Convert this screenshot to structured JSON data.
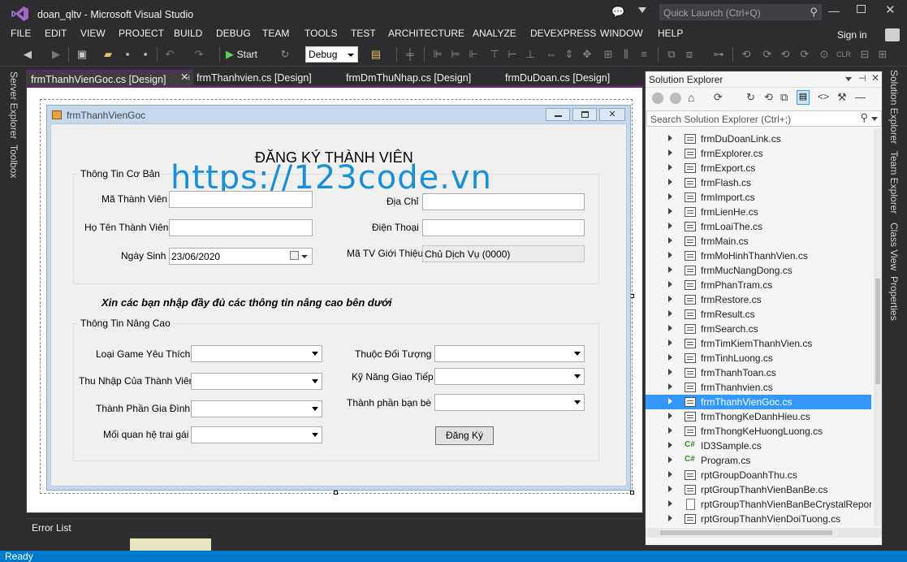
{
  "window": {
    "title": "doan_qltv - Microsoft Visual Studio",
    "quick_launch_placeholder": "Quick Launch (Ctrl+Q)",
    "sign_in": "Sign in"
  },
  "menu": [
    "FILE",
    "EDIT",
    "VIEW",
    "PROJECT",
    "BUILD",
    "DEBUG",
    "TEAM",
    "TOOLS",
    "TEST",
    "ARCHITECTURE",
    "ANALYZE",
    "DEVEXPRESS",
    "WINDOW",
    "HELP"
  ],
  "toolbar": {
    "start_label": "Start",
    "config_value": "Debug"
  },
  "left_rail": {
    "server_explorer": "Server Explorer",
    "toolbox": "Toolbox"
  },
  "right_rail": {
    "solution_explorer": "Solution Explorer",
    "team_explorer": "Team Explorer",
    "class_view": "Class View",
    "properties": "Properties"
  },
  "tabs": [
    {
      "label": "frmThanhVienGoc.cs [Design]",
      "active": true
    },
    {
      "label": "frmThanhvien.cs [Design]",
      "active": false
    },
    {
      "label": "frmDmThuNhap.cs [Design]",
      "active": false
    },
    {
      "label": "frmDuDoan.cs [Design]",
      "active": false
    }
  ],
  "form": {
    "title": "frmThanhVienGoc",
    "heading": "ĐĂNG KÝ THÀNH VIÊN",
    "watermark": "https://123code.vn",
    "basic_group": "Thông Tin Cơ Bản",
    "ma_thanh_vien": "Mã Thành Viên",
    "dia_chi": "Địa Chỉ",
    "ho_ten": "Họ Tên Thành Viên",
    "dien_thoai": "Điện Thoại",
    "ngay_sinh": "Ngày Sinh",
    "ngay_sinh_value": "23/06/2020",
    "ma_tv_gioi_thieu": "Mã TV Giới Thiệu",
    "ma_tv_gioi_thieu_value": "Chủ Dịch Vụ (0000)",
    "instruction": "Xin các bạn nhập đầy đủ các thông tin nâng cao bên dưới",
    "advanced_group": "Thông Tin Nâng Cao",
    "loai_game": "Loại Game Yêu Thích",
    "thuoc_doi_tuong": "Thuộc Đối Tượng",
    "thu_nhap": "Thu Nhập Của Thành Viên",
    "ky_nang": "Kỹ Năng Giao Tiếp",
    "thanh_phan_gia_dinh": "Thành Phần Gia Đình",
    "thanh_phan_ban_be": "Thành phần bạn bè",
    "moi_quan_he": "Mối quan hệ trai gái",
    "register_button": "Đăng Ký"
  },
  "error_list": {
    "title": "Error List"
  },
  "solution_explorer": {
    "title": "Solution Explorer",
    "search_placeholder": "Search Solution Explorer (Ctrl+;)",
    "items": [
      {
        "label": "frmDuDoanLink.cs",
        "icon": "form"
      },
      {
        "label": "frmExplorer.cs",
        "icon": "form"
      },
      {
        "label": "frmExport.cs",
        "icon": "form"
      },
      {
        "label": "frmFlash.cs",
        "icon": "form"
      },
      {
        "label": "frmImport.cs",
        "icon": "form"
      },
      {
        "label": "frmLienHe.cs",
        "icon": "form"
      },
      {
        "label": "frmLoaiThe.cs",
        "icon": "form"
      },
      {
        "label": "frmMain.cs",
        "icon": "form"
      },
      {
        "label": "frmMoHinhThanhVien.cs",
        "icon": "form"
      },
      {
        "label": "frmMucNangDong.cs",
        "icon": "form"
      },
      {
        "label": "frmPhanTram.cs",
        "icon": "form"
      },
      {
        "label": "frmRestore.cs",
        "icon": "form"
      },
      {
        "label": "frmResult.cs",
        "icon": "form"
      },
      {
        "label": "frmSearch.cs",
        "icon": "form"
      },
      {
        "label": "frmTimKiemThanhVien.cs",
        "icon": "form"
      },
      {
        "label": "frmTinhLuong.cs",
        "icon": "form"
      },
      {
        "label": "frmThanhToan.cs",
        "icon": "form"
      },
      {
        "label": "frmThanhvien.cs",
        "icon": "form"
      },
      {
        "label": "frmThanhVienGoc.cs",
        "icon": "form",
        "selected": true
      },
      {
        "label": "frmThongKeDanhHieu.cs",
        "icon": "form"
      },
      {
        "label": "frmThongKeHuongLuong.cs",
        "icon": "form"
      },
      {
        "label": "ID3Sample.cs",
        "icon": "csharp"
      },
      {
        "label": "Program.cs",
        "icon": "csharp"
      },
      {
        "label": "rptGroupDoanhThu.cs",
        "icon": "form"
      },
      {
        "label": "rptGroupThanhVienBanBe.cs",
        "icon": "form"
      },
      {
        "label": "rptGroupThanhVienBanBeCrystalReport",
        "icon": "doc"
      },
      {
        "label": "rptGroupThanhVienDoiTuong.cs",
        "icon": "form"
      }
    ]
  },
  "status": {
    "text": "Ready"
  },
  "colors": {
    "accent": "#007acc",
    "selection": "#3399ff",
    "watermark": "#1a8fd9",
    "vs_purple": "#68217a"
  }
}
